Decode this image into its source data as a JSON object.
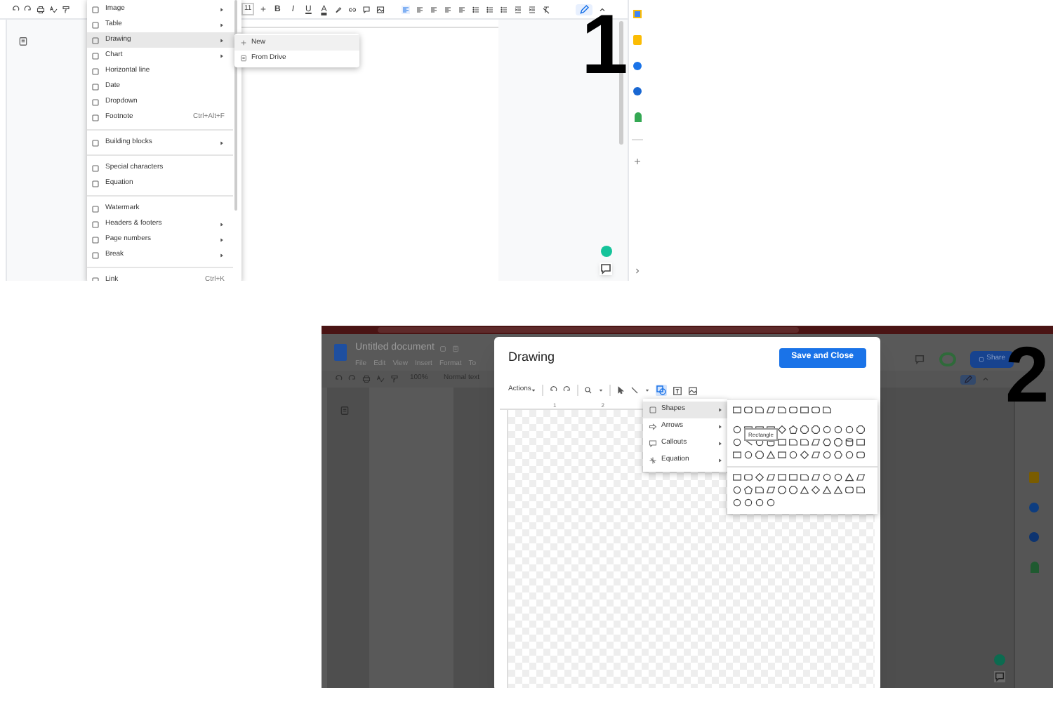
{
  "screenshot_1": {
    "step_number": "1",
    "toolbar": {
      "font_size": "11",
      "format_buttons": [
        "B",
        "I",
        "U",
        "A"
      ]
    },
    "insert_menu": {
      "groups": [
        [
          {
            "label": "Image",
            "submenu": true,
            "selected": false
          },
          {
            "label": "Table",
            "submenu": true,
            "selected": false
          },
          {
            "label": "Drawing",
            "submenu": true,
            "selected": true
          },
          {
            "label": "Chart",
            "submenu": true,
            "selected": false
          },
          {
            "label": "Horizontal line",
            "submenu": false,
            "selected": false
          },
          {
            "label": "Date",
            "submenu": false,
            "selected": false
          },
          {
            "label": "Dropdown",
            "submenu": false,
            "selected": false
          },
          {
            "label": "Footnote",
            "shortcut": "Ctrl+Alt+F",
            "submenu": false,
            "selected": false
          }
        ],
        [
          {
            "label": "Building blocks",
            "submenu": true,
            "selected": false
          }
        ],
        [
          {
            "label": "Special characters",
            "submenu": false,
            "selected": false
          },
          {
            "label": "Equation",
            "submenu": false,
            "selected": false
          }
        ],
        [
          {
            "label": "Watermark",
            "submenu": false,
            "selected": false
          },
          {
            "label": "Headers & footers",
            "submenu": true,
            "selected": false
          },
          {
            "label": "Page numbers",
            "submenu": true,
            "selected": false
          },
          {
            "label": "Break",
            "submenu": true,
            "selected": false
          }
        ],
        [
          {
            "label": "Link",
            "shortcut": "Ctrl+K",
            "submenu": false,
            "selected": false
          }
        ]
      ]
    },
    "drawing_submenu": {
      "items": [
        {
          "label": "New",
          "selected": true
        },
        {
          "label": "From Drive",
          "selected": false
        }
      ]
    }
  },
  "screenshot_2": {
    "step_number": "2",
    "document_title": "Untitled document",
    "menu_bar": [
      "File",
      "Edit",
      "View",
      "Insert",
      "Format",
      "To"
    ],
    "toolbar": {
      "zoom": "100%",
      "style": "Normal text"
    },
    "share_button": "Share",
    "drawing_dialog": {
      "title": "Drawing",
      "save_button": "Save and Close",
      "actions_menu": "Actions",
      "ruler_marks": [
        "1",
        "2"
      ],
      "insert_shape_menu": [
        {
          "label": "Shapes",
          "selected": true
        },
        {
          "label": "Arrows",
          "selected": false
        },
        {
          "label": "Callouts",
          "selected": false
        },
        {
          "label": "Equation",
          "selected": false
        }
      ],
      "shape_tooltip": "Rectangle"
    }
  }
}
